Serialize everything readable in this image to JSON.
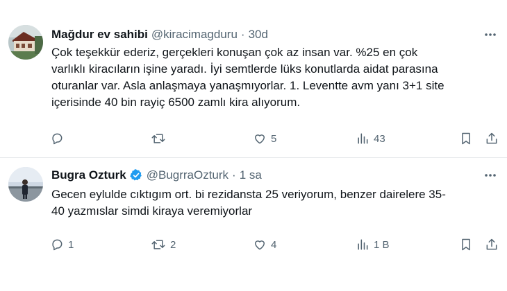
{
  "tweets": [
    {
      "author_name": "Mağdur ev sahibi",
      "author_handle": "@kiracimagduru",
      "separator": "·",
      "time": "30d",
      "verified": false,
      "text_lines": [
        "Çok teşekkür ederiz, gerçekleri konuşan çok az insan var. %25 en çok",
        "varlıklı kiracıların işine yaradı. İyi semtlerde lüks konutlarda aidat parasına",
        "oturanlar var. Asla anlaşmaya yanaşmıyorlar. 1. Leventte avm yanı 3+1 site",
        "içerisinde 40 bin rayiç 6500 zamlı kira alıyorum."
      ],
      "counts": {
        "replies": "",
        "retweets": "",
        "likes": "5",
        "views": "43"
      }
    },
    {
      "author_name": "Bugra Ozturk",
      "author_handle": "@BugrraOzturk",
      "separator": "·",
      "time": "1 sa",
      "verified": true,
      "text_lines": [
        "Gecen eylulde cıktıgım ort. bi rezidansta 25 veriyorum, benzer dairelere 35-",
        "40 yazmıslar simdi kiraya veremiyorlar"
      ],
      "counts": {
        "replies": "1",
        "retweets": "2",
        "likes": "4",
        "views": "1 B"
      }
    }
  ],
  "colors": {
    "text": "#0f1419",
    "secondary": "#536471",
    "verified": "#1d9bf0",
    "divider": "#e6e9ec"
  },
  "icons": [
    "more-icon",
    "reply-icon",
    "retweet-icon",
    "like-icon",
    "views-icon",
    "bookmark-icon",
    "share-icon",
    "verified-badge-icon"
  ]
}
